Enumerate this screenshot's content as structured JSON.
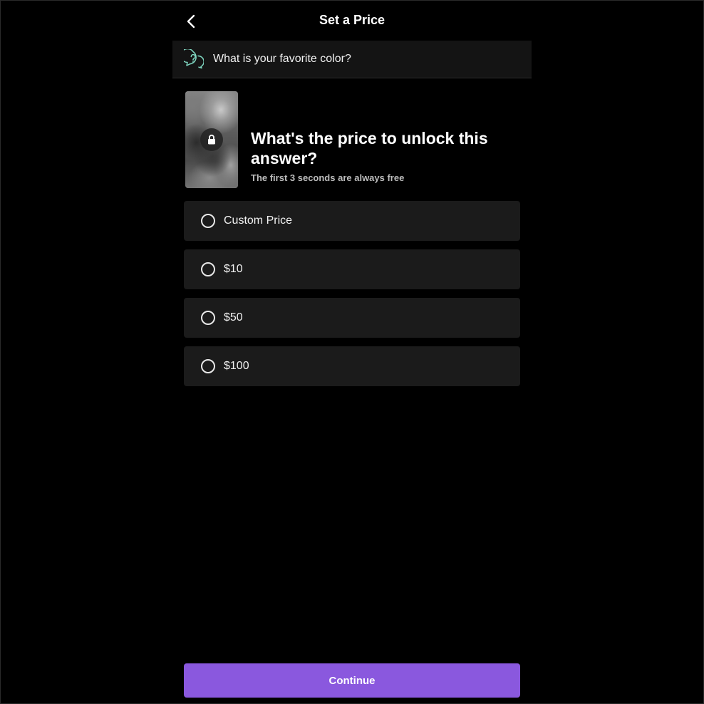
{
  "header": {
    "title": "Set a Price",
    "back_icon": "chevron-left-icon"
  },
  "question": {
    "icon": "question-bubble-icon",
    "icon_color": "#7fd6c0",
    "text": "What is your favorite color?"
  },
  "preview": {
    "lock_icon": "lock-icon"
  },
  "pricing": {
    "title": "What's the price to unlock this answer?",
    "subtitle": "The first 3 seconds are always free",
    "options": [
      {
        "label": "Custom Price",
        "selected": false
      },
      {
        "label": "$10",
        "selected": false
      },
      {
        "label": "$50",
        "selected": false
      },
      {
        "label": "$100",
        "selected": false
      }
    ]
  },
  "footer": {
    "continue_label": "Continue",
    "accent_color": "#8a58de"
  }
}
